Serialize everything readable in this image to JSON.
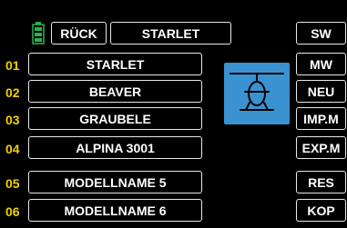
{
  "header": {
    "back_label": "RÜCK",
    "model_title": "STARLET"
  },
  "models": [
    {
      "num": "01",
      "name": "STARLET"
    },
    {
      "num": "02",
      "name": "BEAVER"
    },
    {
      "num": "03",
      "name": "GRAUBELE"
    },
    {
      "num": "04",
      "name": "ALPINA 3001"
    },
    {
      "num": "05",
      "name": "MODELLNAME 5"
    },
    {
      "num": "06",
      "name": "MODELLNAME 6"
    }
  ],
  "side_buttons": [
    "SW",
    "MW",
    "NEU",
    "IMP.M",
    "EXP.M",
    "RES",
    "KOP"
  ],
  "icons": {
    "battery": "battery-icon",
    "model_type": "helicopter-icon"
  },
  "colors": {
    "background": "#000000",
    "number_yellow": "#f0d000",
    "heli_blue": "#3a92d0",
    "battery_green": "#2bb24c"
  }
}
